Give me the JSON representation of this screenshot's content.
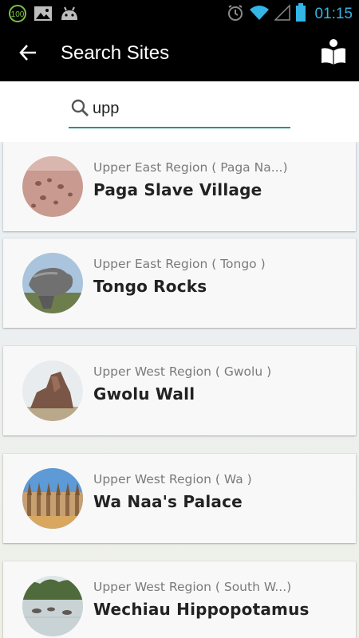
{
  "status_bar": {
    "battery_badge": "100",
    "time": "01:15",
    "icons": [
      "battery-100-notification-icon",
      "image-icon",
      "android-icon",
      "alarm-icon",
      "wifi-icon",
      "signal-icon",
      "battery-icon"
    ]
  },
  "app_bar": {
    "title": "Search Sites",
    "back_icon": "arrow-left-icon",
    "action_icon": "book-reader-icon"
  },
  "search": {
    "value": "upp",
    "icon": "search-icon",
    "accent": "#2a8f8f"
  },
  "results": [
    {
      "region": "Upper East Region ( Paga Na...)",
      "name": "Paga Slave Village"
    },
    {
      "region": "Upper East Region ( Tongo )",
      "name": "Tongo Rocks"
    },
    {
      "region": "Upper West Region ( Gwolu )",
      "name": "Gwolu Wall"
    },
    {
      "region": "Upper West Region ( Wa )",
      "name": "Wa Naa's Palace"
    },
    {
      "region": "Upper West Region ( South W...)",
      "name": "Wechiau Hippopotamus"
    }
  ]
}
